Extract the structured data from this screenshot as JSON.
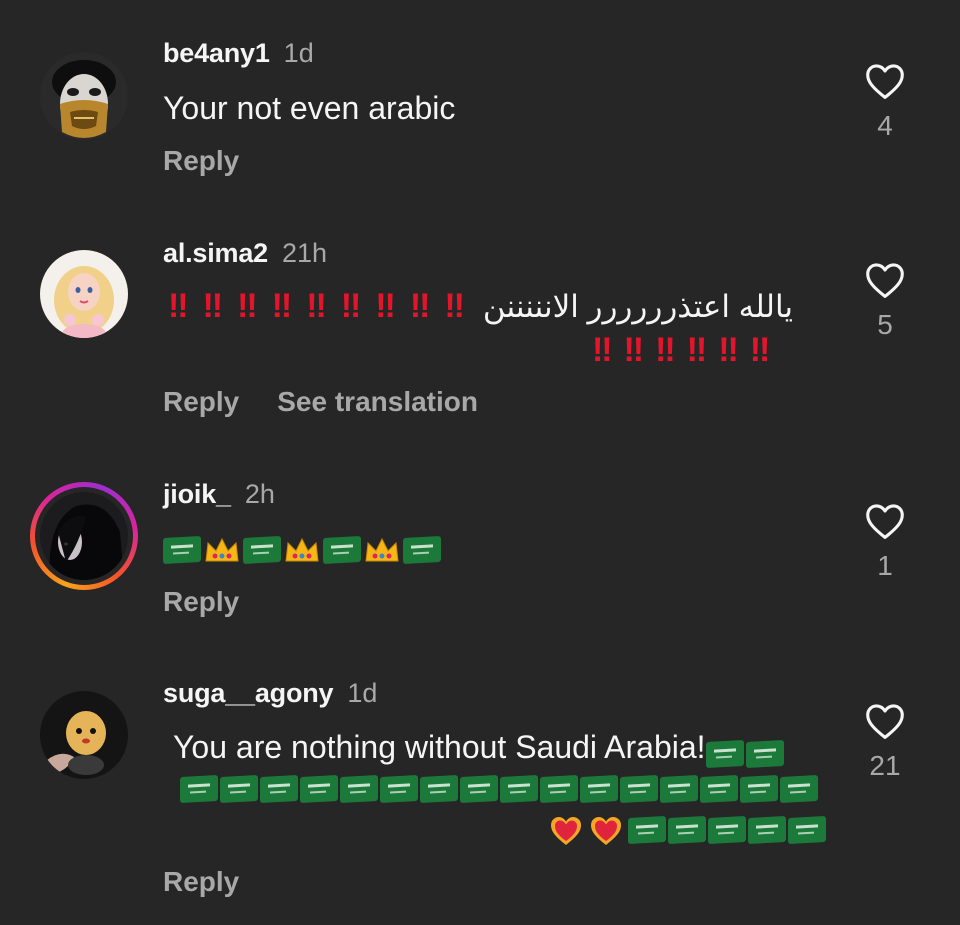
{
  "comments": [
    {
      "username": "be4any1",
      "time": "1d",
      "text": "Your not even arabic",
      "reply_label": "Reply",
      "likes": "4",
      "avatar": "masked-man-avatar"
    },
    {
      "username": "al.sima2",
      "time": "21h",
      "text_arabic": "يالله اعتذرررررر الانننننن",
      "bang_glyph": "‼",
      "reply_label": "Reply",
      "translation_label": "See translation",
      "likes": "5",
      "avatar": "doll-avatar"
    },
    {
      "username": "jioik_",
      "time": "2h",
      "reply_label": "Reply",
      "likes": "1",
      "avatar": "dark-hair-avatar",
      "emoji_sequence": [
        "saudi-flag",
        "crown",
        "saudi-flag",
        "crown",
        "saudi-flag",
        "crown",
        "saudi-flag"
      ]
    },
    {
      "username": "suga__agony",
      "time": "1d",
      "text": "You are nothing without Saudi Arabia!",
      "reply_label": "Reply",
      "likes": "21",
      "avatar": "plush-toy-avatar"
    }
  ],
  "colors": {
    "background": "#262626",
    "primary_text": "#f5f5f5",
    "secondary_text": "#a8a8a8",
    "bang_red": "#e3152b",
    "flag_green": "#1b7a3a"
  }
}
